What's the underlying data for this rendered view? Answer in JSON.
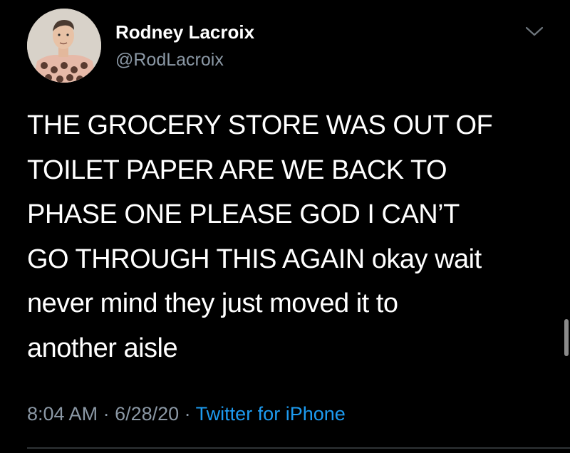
{
  "user": {
    "display_name": "Rodney Lacroix",
    "handle": "@RodLacroix"
  },
  "tweet": {
    "lines": [
      "THE GROCERY STORE WAS OUT OF",
      "TOILET PAPER ARE WE BACK TO",
      "PHASE ONE PLEASE GOD I CAN’T",
      "GO THROUGH THIS AGAIN okay wait",
      "never mind they just moved it to",
      "another aisle"
    ]
  },
  "meta": {
    "time": "8:04 AM",
    "separator": " · ",
    "date": "6/28/20",
    "source": "Twitter for iPhone"
  },
  "icons": {
    "more": "chevron-down-icon"
  },
  "colors": {
    "background": "#000000",
    "text": "#ffffff",
    "secondary": "#8b98a5",
    "link": "#1d9bf0"
  }
}
